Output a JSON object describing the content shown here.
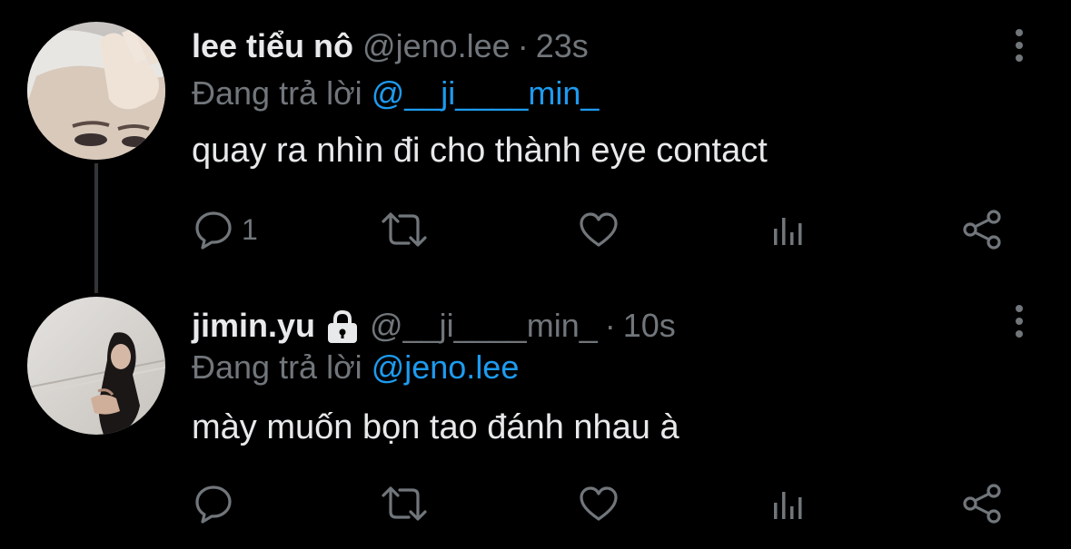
{
  "colors": {
    "background": "#000000",
    "text_primary": "#e7e9ea",
    "text_secondary": "#71767b",
    "accent": "#1d9bf0",
    "thread_line": "#333639"
  },
  "tweets": [
    {
      "display_name": "lee tiểu nô",
      "protected": false,
      "handle": "@jeno.lee",
      "separator": "·",
      "time": "23s",
      "reply_prefix": "Đang trả lời",
      "reply_to": "@__ji____min_",
      "text": "quay ra nhìn đi cho thành eye contact",
      "reply_count": "1",
      "icons": [
        "more-icon",
        "reply-icon",
        "retweet-icon",
        "like-icon",
        "views-icon",
        "share-icon"
      ]
    },
    {
      "display_name": "jimin.yu",
      "protected": true,
      "handle": "@__ji____min_",
      "separator": "·",
      "time": "10s",
      "reply_prefix": "Đang trả lời",
      "reply_to": "@jeno.lee",
      "text": "mày muốn bọn tao đánh nhau à",
      "reply_count": "",
      "icons": [
        "lock-icon",
        "more-icon",
        "reply-icon",
        "retweet-icon",
        "like-icon",
        "views-icon",
        "share-icon"
      ]
    }
  ]
}
